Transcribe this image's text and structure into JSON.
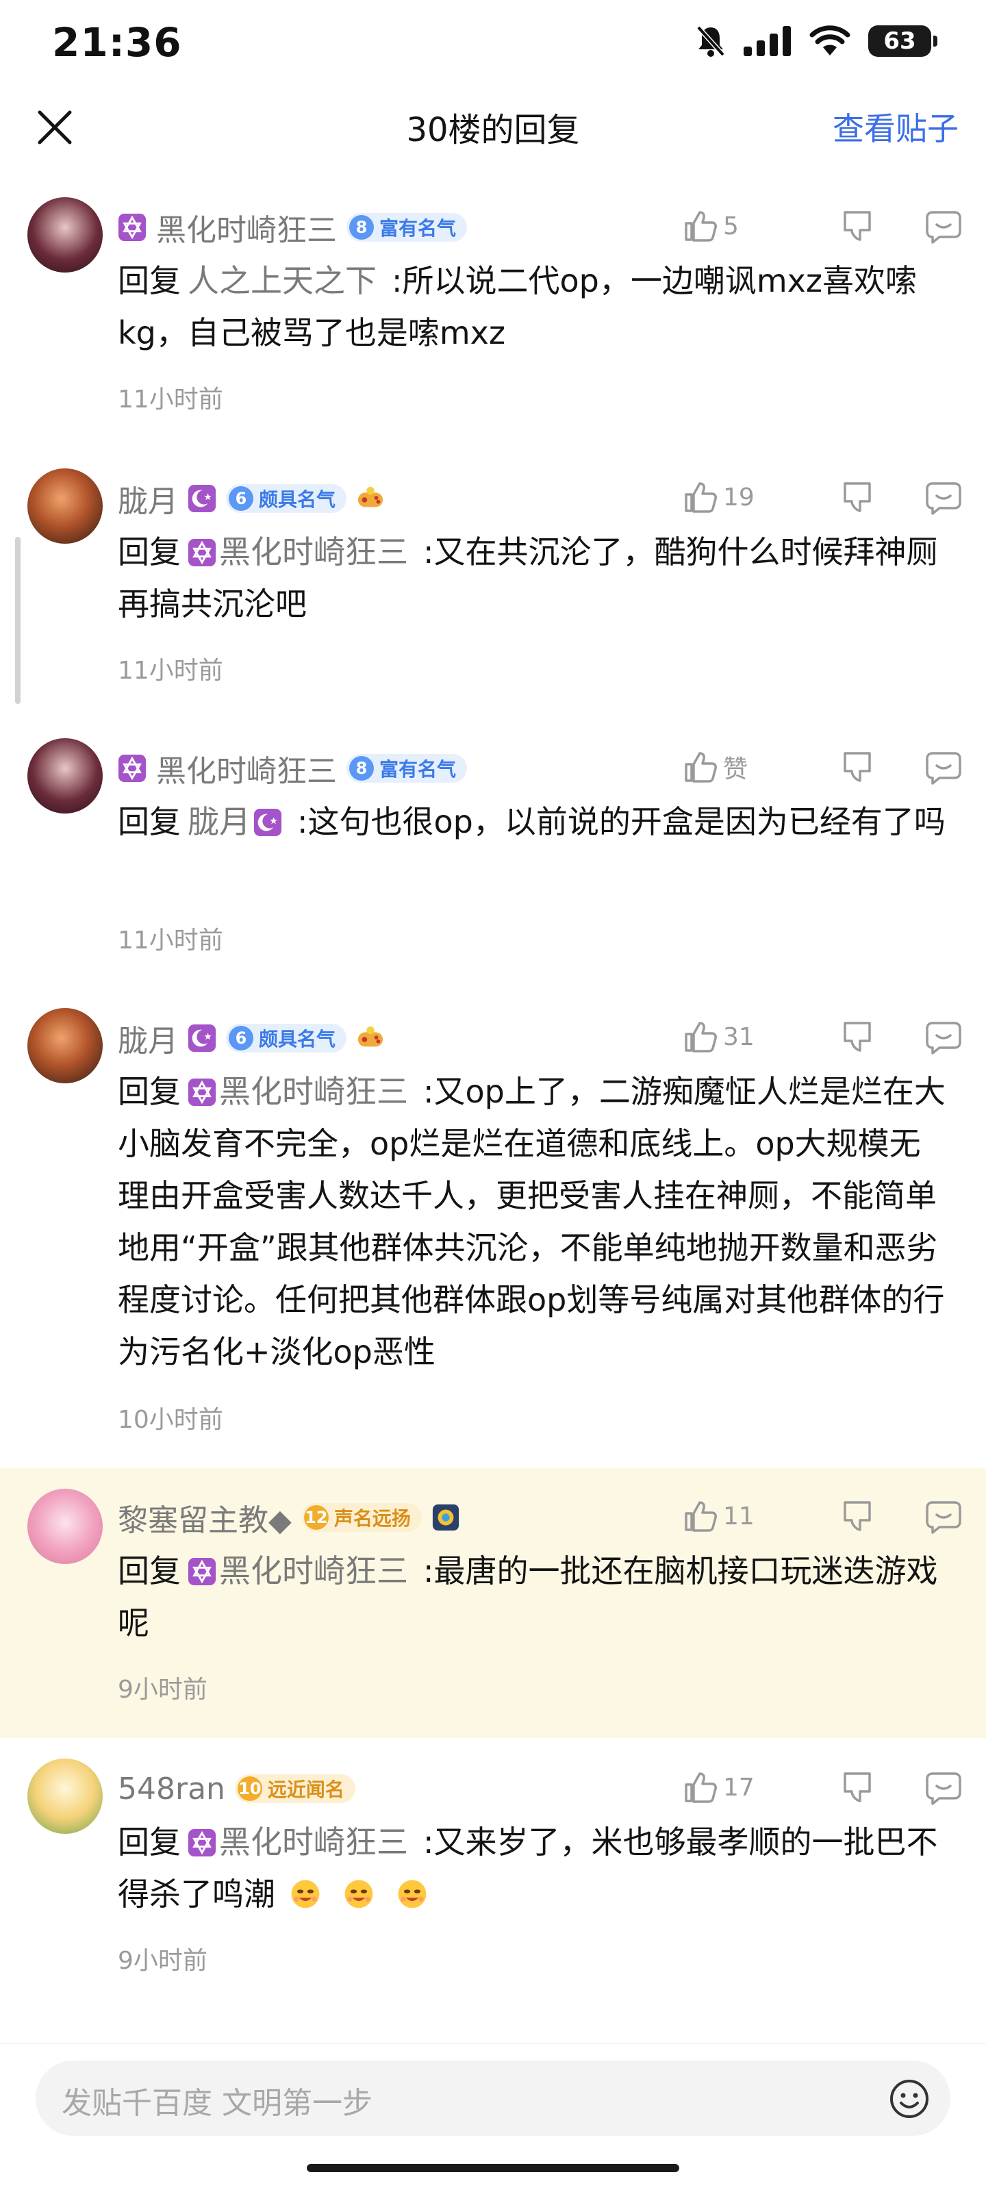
{
  "status": {
    "time": "21:36",
    "battery": "63"
  },
  "nav": {
    "title": "30楼的回复",
    "action": "查看贴子"
  },
  "reply_prefix": "回复",
  "comments": [
    {
      "user": "黑化时崎狂三",
      "level": "8",
      "badge": "富有名气",
      "likes": "5",
      "reply_to": "人之上天之下",
      "text": ":所以说二代op，一边嘲讽mxz喜欢嗦kg，自己被骂了也是嗦mxz",
      "time": "11小时前"
    },
    {
      "user": "胧月",
      "level": "6",
      "badge": "颇具名气",
      "likes": "19",
      "reply_to": "黑化时崎狂三",
      "text": ":又在共沉沦了，酷狗什么时候拜神厕再搞共沉沦吧",
      "time": "11小时前"
    },
    {
      "user": "黑化时崎狂三",
      "level": "8",
      "badge": "富有名气",
      "likes": "赞",
      "reply_to": "胧月",
      "text": ":这句也很op，以前说的开盒是因为已经有了吗",
      "time": "11小时前"
    },
    {
      "user": "胧月",
      "level": "6",
      "badge": "颇具名气",
      "likes": "31",
      "reply_to": "黑化时崎狂三",
      "text": ":又op上了，二游痴魔怔人烂是烂在大小脑发育不完全，op烂是烂在道德和底线上。op大规模无理由开盒受害人数达千人，更把受害人挂在神厕，不能简单地用“开盒”跟其他群体共沉沦，不能单纯地抛开数量和恶劣程度讨论。任何把其他群体跟op划等号纯属对其他群体的行为污名化+淡化op恶性",
      "time": "10小时前"
    },
    {
      "user": "黎塞留主教◆",
      "level": "12",
      "badge": "声名远扬",
      "likes": "11",
      "reply_to": "黑化时崎狂三",
      "text": ":最唐的一批还在脑机接口玩迷迭游戏呢",
      "time": "9小时前"
    },
    {
      "user": "548ran",
      "level": "10",
      "badge": "远近闻名",
      "likes": "17",
      "reply_to": "黑化时崎狂三",
      "text": ":又来岁了，米也够最孝顺的一批巴不得杀了鸣潮",
      "time": "9小时前"
    }
  ],
  "input": {
    "placeholder": "发贴千百度 文明第一步"
  },
  "colors": {
    "accent": "#3a6ee8",
    "highlight_bg": "#fdf8e4",
    "badge_blue": "#3b7ae8",
    "badge_gold": "#d9901a"
  },
  "icons": [
    "close-icon",
    "thumb-up-icon",
    "dislike-icon",
    "comment-icon",
    "emoji-icon",
    "star-of-david-icon",
    "crescent-star-icon"
  ]
}
